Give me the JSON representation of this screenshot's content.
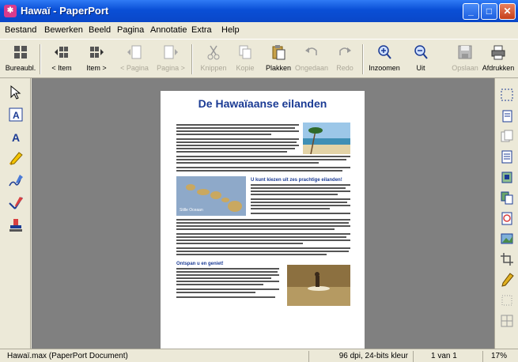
{
  "window": {
    "title": "Hawaï - PaperPort"
  },
  "menu": [
    "Bestand",
    "Bewerken",
    "Beeld",
    "Pagina",
    "Annotatie",
    "Extra",
    "Help"
  ],
  "toolbar": {
    "buttons": [
      {
        "label": "Bureaubl.",
        "icon": "desktop-icon"
      },
      {
        "label": "< Item",
        "icon": "prev-item-icon"
      },
      {
        "label": "Item >",
        "icon": "next-item-icon"
      },
      {
        "label": "< Pagina",
        "icon": "prev-page-icon"
      },
      {
        "label": "Pagina >",
        "icon": "next-page-icon"
      },
      {
        "label": "Knippen",
        "icon": "scissors-icon"
      },
      {
        "label": "Kopie",
        "icon": "copy-icon"
      },
      {
        "label": "Plakken",
        "icon": "paste-icon"
      },
      {
        "label": "Ongedaan",
        "icon": "undo-icon"
      },
      {
        "label": "Redo",
        "icon": "redo-icon"
      },
      {
        "label": "Inzoomen",
        "icon": "zoom-in-icon"
      },
      {
        "label": "Uit",
        "icon": "zoom-out-icon"
      },
      {
        "label": "Opslaan",
        "icon": "save-icon"
      },
      {
        "label": "Afdrukken",
        "icon": "print-icon"
      }
    ]
  },
  "document": {
    "title": "De Hawaïaanse eilanden",
    "subhead1": "U kunt kiezen uit zes prachtige eilanden!",
    "subhead2": "Ontspan u en geniet!",
    "map_label": "Stille Oceaan"
  },
  "status": {
    "file": "Hawaï.max (PaperPort Document)",
    "resolution": "96 dpi, 24-bits kleur",
    "page": "1 van 1",
    "zoom": "17%"
  }
}
